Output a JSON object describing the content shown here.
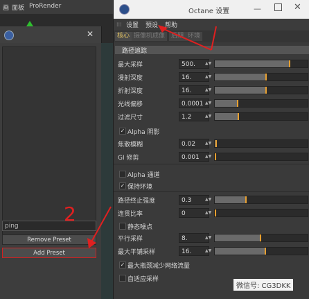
{
  "host": {
    "menu": [
      "画",
      "面板",
      "ProRender"
    ]
  },
  "left_panel": {
    "input_value": "ping",
    "remove_label": "Remove Preset",
    "add_label": "Add Preset"
  },
  "dialog": {
    "title": "Octane 设置",
    "menu": [
      "设置",
      "预设",
      "帮助"
    ],
    "tabs": [
      "核心",
      "摄像机成像",
      "后期",
      "环境"
    ],
    "section": "路径追踪",
    "rows": [
      {
        "label": "最大采样",
        "value": "500.",
        "fraction": 0.81
      },
      {
        "label": "漫射深度",
        "value": "16.",
        "fraction": 0.56
      },
      {
        "label": "折射深度",
        "value": "16.",
        "fraction": 0.56
      },
      {
        "label": "光线偏移",
        "value": "0.0001",
        "fraction": 0.25
      },
      {
        "label": "过滤尺寸",
        "value": "1.2",
        "fraction": 0.26
      },
      {
        "label": "Alpha 阴影",
        "checkbox": true,
        "checked": true
      },
      {
        "label": "焦散模糊",
        "value": "0.02",
        "fraction": 0.02
      },
      {
        "label": "GI 修剪",
        "value": "0.001",
        "fraction": 0.01
      },
      {
        "label": "Alpha 通道",
        "checkbox": true,
        "checked": false
      },
      {
        "label": "保持环境",
        "checkbox": true,
        "checked": true
      },
      {
        "label": "路径终止强度",
        "value": "0.3",
        "fraction": 0.34
      },
      {
        "label": "连贯比率",
        "value": "0",
        "fraction": 0.0
      },
      {
        "label": "静态噪点",
        "checkbox": true,
        "checked": false
      },
      {
        "label": "平行采样",
        "value": "8.",
        "fraction": 0.5
      },
      {
        "label": "最大平铺采样",
        "value": "16.",
        "fraction": 0.55
      },
      {
        "label": "最大瓶颈减少网络流量",
        "checkbox": true,
        "checked": true
      },
      {
        "label": "自适应采样",
        "checkbox": true,
        "checked": false
      }
    ]
  },
  "watermark": "微信号: CG3DKK",
  "annotation": "2",
  "colors": {
    "arrow": "#e02020",
    "accent": "#e8a030"
  }
}
